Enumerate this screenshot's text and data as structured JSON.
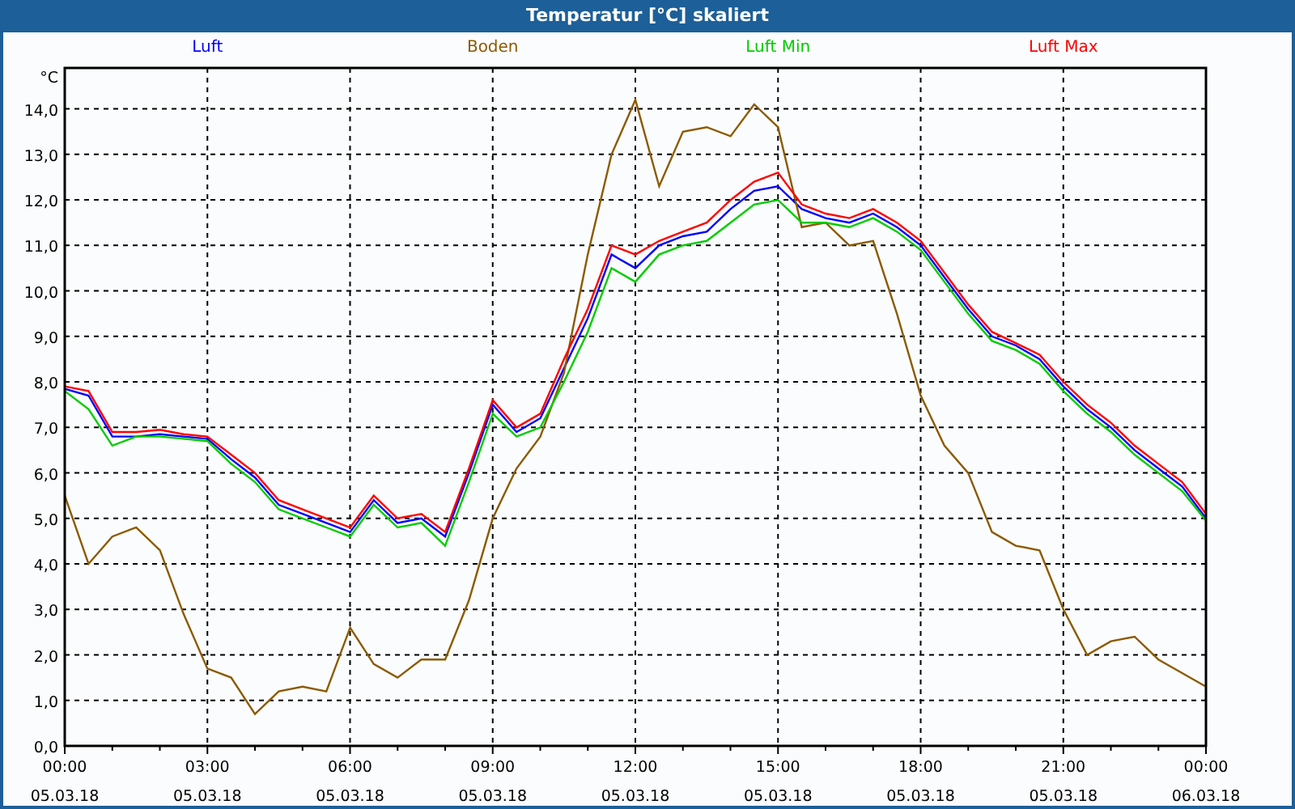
{
  "window": {
    "title": "Temperatur [°C] skaliert"
  },
  "chart": {
    "chart_data": {
      "type": "line",
      "ylabel": "°C",
      "grid": true,
      "categories": [
        "00:00\n05.03.18",
        null,
        null,
        null,
        null,
        null,
        "03:00\n05.03.18",
        null,
        null,
        null,
        null,
        null,
        "06:00\n05.03.18",
        null,
        null,
        null,
        null,
        null,
        "09:00\n05.03.18",
        null,
        null,
        null,
        null,
        null,
        "12:00\n05.03.18",
        null,
        null,
        null,
        null,
        null,
        "15:00\n05.03.18",
        null,
        null,
        null,
        null,
        null,
        "18:00\n05.03.18",
        null,
        null,
        null,
        null,
        null,
        "21:00\n05.03.18",
        null,
        null,
        null,
        null,
        null,
        "00:00\n06.03.18"
      ],
      "series": [
        {
          "name": "Luft",
          "color": "#0000ff",
          "values": [
            7.85,
            7.7,
            6.8,
            6.8,
            6.85,
            6.8,
            6.75,
            6.3,
            5.9,
            5.3,
            5.1,
            4.9,
            4.7,
            5.4,
            4.9,
            5.0,
            4.6,
            6.0,
            7.5,
            6.9,
            7.2,
            8.3,
            9.4,
            10.8,
            10.5,
            11.0,
            11.2,
            11.3,
            11.8,
            12.2,
            12.3,
            11.8,
            11.6,
            11.5,
            11.7,
            11.4,
            11.0,
            10.3,
            9.6,
            9.0,
            8.8,
            8.5,
            7.9,
            7.4,
            7.0,
            6.5,
            6.1,
            5.7,
            5.0
          ]
        },
        {
          "name": "Boden",
          "color": "#8c5a00",
          "values": [
            5.5,
            4.0,
            4.6,
            4.8,
            4.3,
            2.9,
            1.7,
            1.5,
            0.7,
            1.2,
            1.3,
            1.2,
            2.6,
            1.8,
            1.5,
            1.9,
            1.9,
            3.2,
            5.0,
            6.1,
            6.8,
            8.2,
            10.8,
            13.0,
            14.2,
            12.3,
            13.5,
            13.6,
            13.4,
            14.1,
            13.6,
            11.4,
            11.5,
            11.0,
            11.1,
            9.5,
            7.7,
            6.6,
            6.0,
            4.7,
            4.4,
            4.3,
            3.0,
            2.0,
            2.3,
            2.4,
            1.9,
            1.6,
            1.3
          ]
        },
        {
          "name": "Luft Min",
          "color": "#00cc00",
          "values": [
            7.8,
            7.4,
            6.6,
            6.8,
            6.8,
            6.75,
            6.7,
            6.2,
            5.8,
            5.2,
            5.0,
            4.8,
            4.6,
            5.3,
            4.8,
            4.9,
            4.4,
            5.8,
            7.3,
            6.8,
            7.0,
            8.0,
            9.1,
            10.5,
            10.2,
            10.8,
            11.0,
            11.1,
            11.5,
            11.9,
            12.0,
            11.5,
            11.5,
            11.4,
            11.6,
            11.3,
            10.9,
            10.2,
            9.5,
            8.9,
            8.7,
            8.4,
            7.8,
            7.3,
            6.9,
            6.4,
            6.0,
            5.6,
            4.95
          ]
        },
        {
          "name": "Luft Max",
          "color": "#ff0000",
          "values": [
            7.9,
            7.8,
            6.9,
            6.9,
            6.95,
            6.85,
            6.8,
            6.4,
            6.0,
            5.4,
            5.2,
            5.0,
            4.8,
            5.5,
            5.0,
            5.1,
            4.7,
            6.1,
            7.6,
            7.0,
            7.3,
            8.5,
            9.6,
            11.0,
            10.8,
            11.1,
            11.3,
            11.5,
            12.0,
            12.4,
            12.6,
            11.9,
            11.7,
            11.6,
            11.8,
            11.5,
            11.1,
            10.4,
            9.7,
            9.1,
            8.85,
            8.6,
            8.0,
            7.5,
            7.1,
            6.6,
            6.2,
            5.8,
            5.1
          ]
        }
      ],
      "ylim": [
        0,
        14.9
      ],
      "yticks": [
        {
          "value": 0,
          "label": "0,0"
        },
        {
          "value": 1,
          "label": "1,0"
        },
        {
          "value": 2,
          "label": "2,0"
        },
        {
          "value": 3,
          "label": "3,0"
        },
        {
          "value": 4,
          "label": "4,0"
        },
        {
          "value": 5,
          "label": "5,0"
        },
        {
          "value": 6,
          "label": "6,0"
        },
        {
          "value": 7,
          "label": "7,0"
        },
        {
          "value": 8,
          "label": "8,0"
        },
        {
          "value": 9,
          "label": "9,0"
        },
        {
          "value": 10,
          "label": "10,0"
        },
        {
          "value": 11,
          "label": "11,0"
        },
        {
          "value": 12,
          "label": "12,0"
        },
        {
          "value": 13,
          "label": "13,0"
        },
        {
          "value": 14,
          "label": "14,0"
        }
      ]
    }
  }
}
